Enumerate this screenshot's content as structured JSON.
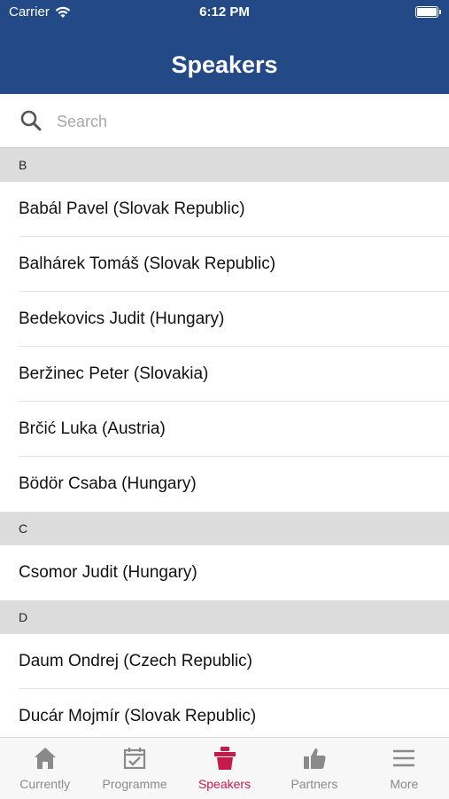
{
  "status_bar": {
    "carrier": "Carrier",
    "time": "6:12 PM"
  },
  "header": {
    "title": "Speakers"
  },
  "search": {
    "placeholder": "Search"
  },
  "sections": [
    {
      "letter": "B",
      "items": [
        "Babál Pavel (Slovak Republic)",
        "Balhárek Tomáš (Slovak Republic)",
        "Bedekovics Judit (Hungary)",
        "Beržinec Peter (Slovakia)",
        "Brčić Luka (Austria)",
        "Bödör Csaba (Hungary)"
      ]
    },
    {
      "letter": "C",
      "items": [
        "Csomor Judit (Hungary)"
      ]
    },
    {
      "letter": "D",
      "items": [
        "Daum Ondrej (Czech Republic)",
        "Ducár Mojmír (Slovak Republic)"
      ]
    }
  ],
  "tabbar": {
    "active_color": "#c41c4a",
    "inactive_color": "#8a8a8a",
    "tabs": [
      {
        "label": "Currently",
        "icon": "home-icon"
      },
      {
        "label": "Programme",
        "icon": "calendar-check-icon"
      },
      {
        "label": "Speakers",
        "icon": "podium-icon",
        "active": true
      },
      {
        "label": "Partners",
        "icon": "thumbs-up-icon"
      },
      {
        "label": "More",
        "icon": "menu-icon"
      }
    ]
  },
  "colors": {
    "header_bg": "#234a86",
    "section_bg": "#dcdcdc"
  }
}
